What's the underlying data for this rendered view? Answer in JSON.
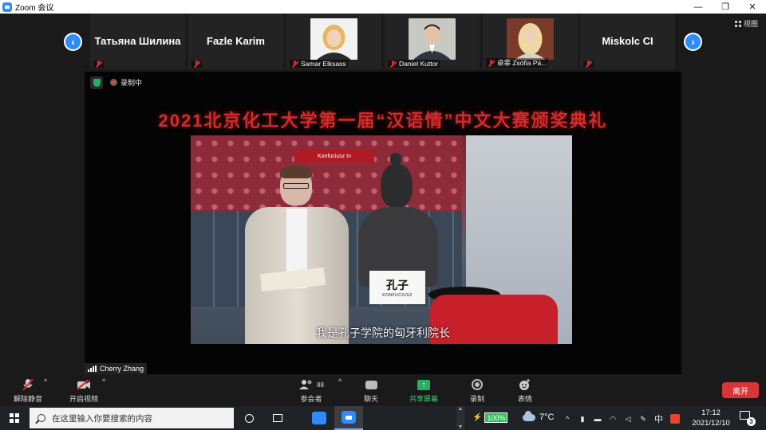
{
  "window": {
    "title": "Zoom 会议",
    "controls": [
      "—",
      "❐",
      "✕"
    ]
  },
  "gallery": {
    "view_label": "视图",
    "participants": [
      {
        "display": "Татьяна Шилина",
        "footer": "",
        "has_video": false
      },
      {
        "display": "Fazle Karim",
        "footer": "",
        "has_video": false
      },
      {
        "display": "",
        "footer": "Samar Elksass",
        "has_video": true
      },
      {
        "display": "",
        "footer": "Daniel Kuttor",
        "has_video": true
      },
      {
        "display": "",
        "footer": "卓菲 Zsófia Pá...",
        "has_video": true
      },
      {
        "display": "Miskolc CI",
        "footer": "",
        "has_video": false
      }
    ]
  },
  "stage": {
    "recording_label": "录制中",
    "banner": "2021北京化工大学第一届“汉语情”中文大赛颁奖典礼",
    "scene_sign": "Konfuciusz In",
    "plaque_cn": "孔子",
    "plaque_en": "KONFUCIUSZ",
    "subtitle": "我是孔子学院的匈牙利院长",
    "speaker_name": "Cherry Zhang"
  },
  "toolbar": {
    "unmute": "解除静音",
    "start_video": "开启视频",
    "participants_label": "参会者",
    "participants_count": "88",
    "chat": "聊天",
    "share": "共享屏幕",
    "record": "录制",
    "reactions": "表情",
    "leave": "离开"
  },
  "taskbar": {
    "search_placeholder": "在这里输入你要搜索的内容",
    "battery": "100%",
    "temperature": "7°C",
    "ime": "中",
    "time": "17:12",
    "date": "2021/12/10",
    "notifications": "3"
  }
}
